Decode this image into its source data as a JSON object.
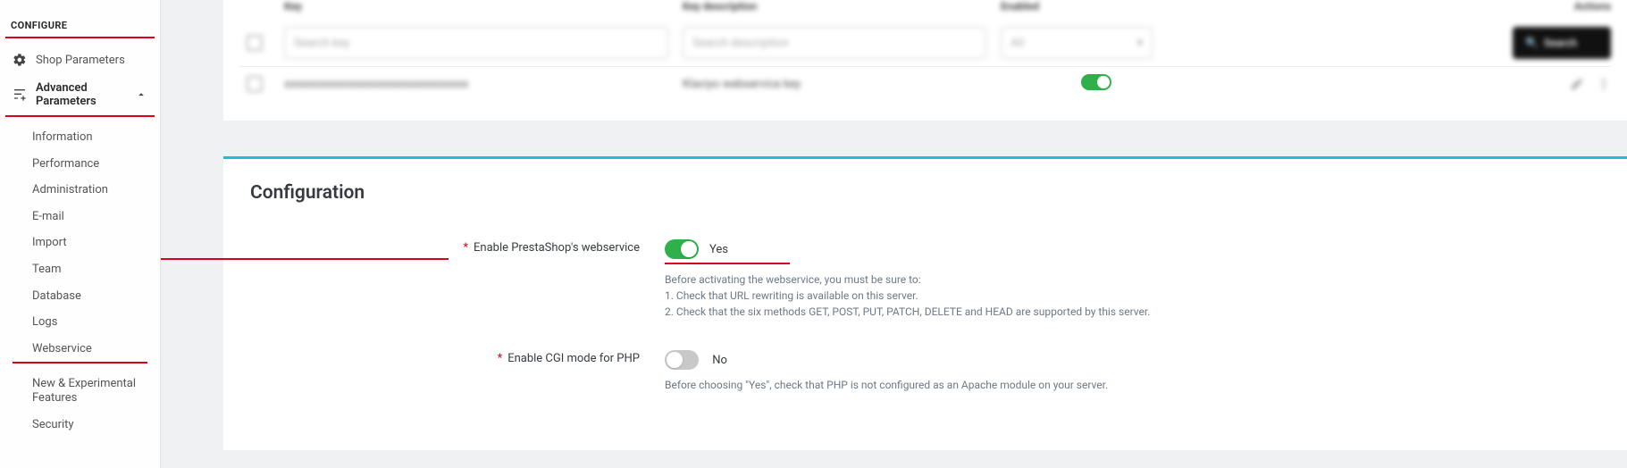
{
  "sidebar": {
    "section_header": "CONFIGURE",
    "shop_parameters": "Shop Parameters",
    "advanced_parameters": "Advanced Parameters",
    "sub": {
      "information": "Information",
      "performance": "Performance",
      "administration": "Administration",
      "email": "E-mail",
      "import": "Import",
      "team": "Team",
      "database": "Database",
      "logs": "Logs",
      "webservice": "Webservice",
      "new_exp": "New & Experimental Features",
      "security": "Security"
    }
  },
  "table": {
    "head": {
      "key": "Key",
      "desc": "Key description",
      "enabled": "Enabled",
      "actions": "Actions"
    },
    "filter": {
      "key_ph": "Search key",
      "desc_ph": "Search description",
      "enabled_ph": "All",
      "btn": "Search"
    },
    "row": {
      "key_txt": "xxxxxxxxxxxxxxxxxxxxxxxxxxxxxxxx",
      "desc_txt": "Klaviyo webservice key"
    }
  },
  "config": {
    "title": "Configuration",
    "row1": {
      "label": "Enable PrestaShop's webservice",
      "value_label": "Yes",
      "help_line0": "Before activating the webservice, you must be sure to:",
      "help_line1": "1. Check that URL rewriting is available on this server.",
      "help_line2": "2. Check that the six methods GET, POST, PUT, PATCH, DELETE and HEAD are supported by this server."
    },
    "row2": {
      "label": "Enable CGI mode for PHP",
      "value_label": "No",
      "help": "Before choosing \"Yes\", check that PHP is not configured as an Apache module on your server."
    }
  }
}
